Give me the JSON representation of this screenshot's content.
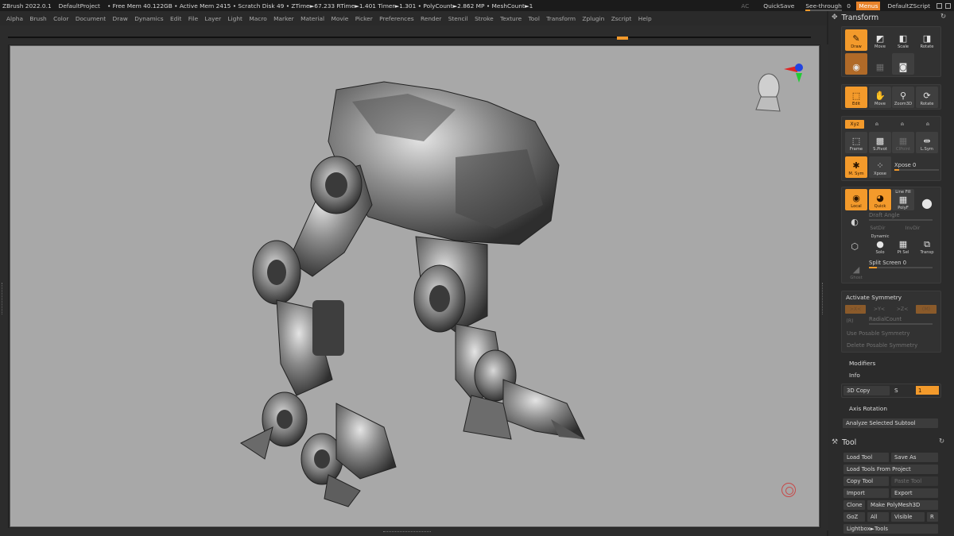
{
  "titlebar": {
    "app": "ZBrush 2022.0.1",
    "project": "DefaultProject",
    "status": "• Free Mem 40.122GB • Active Mem 2415 • Scratch Disk 49 • ZTime►67.233 RTime►1.401 Timer►1.301 • PolyCount►2.862 MP • MeshCount►1",
    "ac": "AC",
    "quicksave": "QuickSave",
    "see_through_label": "See-through",
    "see_through_value": "0",
    "menus": "Menus",
    "script": "DefaultZScript"
  },
  "menubar": {
    "items": [
      "Alpha",
      "Brush",
      "Color",
      "Document",
      "Draw",
      "Dynamics",
      "Edit",
      "File",
      "Layer",
      "Light",
      "Macro",
      "Marker",
      "Material",
      "Movie",
      "Picker",
      "Preferences",
      "Render",
      "Stencil",
      "Stroke",
      "Texture",
      "Tool",
      "Transform",
      "Zplugin",
      "Zscript",
      "Help"
    ]
  },
  "transform": {
    "title": "Transform",
    "modes": {
      "draw": "Draw",
      "move": "Move",
      "scale": "Scale",
      "rotate": "Rotate"
    },
    "edit_row": {
      "edit": "Edit",
      "move": "Move",
      "zoom3d": "Zoom3D",
      "rotate": "Rotate"
    },
    "axis": {
      "xyz": "Xyz"
    },
    "frame_row": {
      "frame": "Frame",
      "sfloor": "S.Pivot",
      "clpt": "ClPoint",
      "lsym": "L.Sym"
    },
    "sym_row": {
      "msym": "M. Sym",
      "xpose_btn": "Xpose",
      "xpose_label": "Xpose 0"
    },
    "local_row": {
      "local": "Local",
      "quick": "Quick",
      "linefill_top": "Line Fill",
      "linefill": "PolyF"
    },
    "draft": {
      "draft_angle": "Draft Angle",
      "setdir": "SetDir",
      "invdir": "InvDir"
    },
    "solo_row": {
      "dynamic_top": "Dynamic",
      "solo": "Solo",
      "ptsel": "Pt Sel",
      "transp": "Transp"
    },
    "ghost": "Ghost",
    "split_screen": "Split Screen 0"
  },
  "symmetry": {
    "activate": "Activate Symmetry",
    "axes": [
      ">X<",
      ">Y<",
      ">Z<",
      "(M)"
    ],
    "r": "(R)",
    "radial": "RadialCount",
    "use_posable": "Use Posable Symmetry",
    "delete_posable": "Delete Posable Symmetry"
  },
  "modifiers": "Modifiers",
  "info": "Info",
  "copy3d": {
    "label": "3D Copy",
    "s": "S",
    "value": "1"
  },
  "axis_rotation": "Axis Rotation",
  "analyze": "Analyze Selected Subtool",
  "tool": {
    "title": "Tool",
    "load_tool": "Load Tool",
    "save_as": "Save As",
    "load_from_project": "Load Tools From Project",
    "copy_tool": "Copy Tool",
    "paste_tool": "Paste Tool",
    "import": "Import",
    "export": "Export",
    "clone": "Clone",
    "make_polymesh": "Make PolyMesh3D",
    "goz": "GoZ",
    "all": "All",
    "visible": "Visible",
    "r": "R",
    "lightbox": "Lightbox►Tools"
  },
  "colors": {
    "accent": "#f39a2b",
    "canvas": "#a8a8a8",
    "panel": "#2b2b2b"
  }
}
